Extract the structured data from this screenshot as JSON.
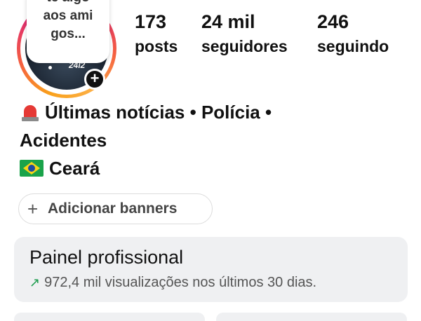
{
  "profile": {
    "note_lines": [
      "te algo",
      "aos ami",
      "gos..."
    ],
    "avatar_caption": "24l2",
    "add_story_glyph": "+"
  },
  "stats": [
    {
      "value": "173",
      "label": "posts"
    },
    {
      "value": "24 mil",
      "label": "seguidores"
    },
    {
      "value": "246",
      "label": "seguindo"
    }
  ],
  "bio": {
    "line1_icon": "police-siren-emoji",
    "line1": "Últimas notícias • Polícia •",
    "line2": "Acidentes",
    "line3_icon": "brazil-flag-emoji",
    "line3": "Ceará"
  },
  "banner_button": {
    "icon": "plus-icon",
    "label": "Adicionar banners"
  },
  "dashboard": {
    "title": "Painel profissional",
    "trend_icon": "trend-up-arrow-icon",
    "subtitle": "972,4 mil visualizações nos últimos 30 dias."
  },
  "colors": {
    "ring_gradient": [
      "#f9a11b",
      "#f56040",
      "#e1306c",
      "#c13584"
    ],
    "trend_green": "#1a9b4b",
    "card_bg": "#eff0f2"
  }
}
